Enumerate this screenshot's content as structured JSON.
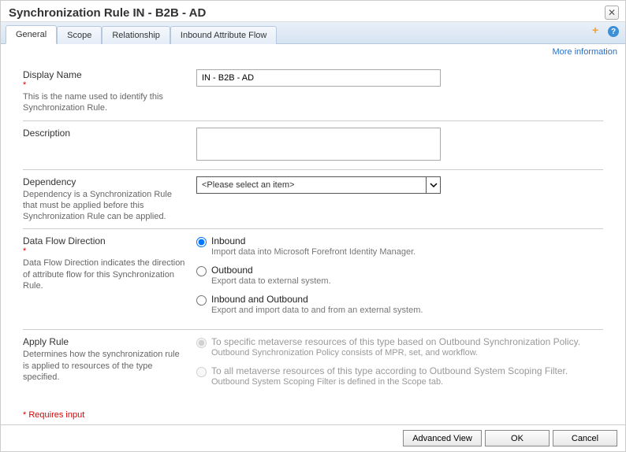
{
  "title": "Synchronization Rule IN - B2B - AD",
  "tabs": [
    "General",
    "Scope",
    "Relationship",
    "Inbound Attribute Flow"
  ],
  "activeTab": 0,
  "moreInfoLabel": "More information",
  "fields": {
    "displayName": {
      "label": "Display Name",
      "help": "This is the name used to identify this Synchronization Rule.",
      "value": "IN - B2B - AD",
      "required": true
    },
    "description": {
      "label": "Description",
      "value": ""
    },
    "dependency": {
      "label": "Dependency",
      "help": "Dependency is a Synchronization Rule that must be applied before this Synchronization Rule can be applied.",
      "placeholder": "<Please select an item>"
    },
    "dataFlow": {
      "label": "Data Flow Direction",
      "help": "Data Flow Direction indicates the direction of attribute flow for this Synchronization Rule.",
      "required": true,
      "options": [
        {
          "label": "Inbound",
          "desc": "Import data into Microsoft Forefront Identity Manager.",
          "selected": true
        },
        {
          "label": "Outbound",
          "desc": "Export data to external system.",
          "selected": false
        },
        {
          "label": "Inbound and Outbound",
          "desc": "Export and import data to and from an external system.",
          "selected": false
        }
      ]
    },
    "applyRule": {
      "label": "Apply Rule",
      "help": "Determines how the synchronization rule is applied to resources of the type specified.",
      "options": [
        {
          "label": "To specific metaverse resources of this type based on Outbound Synchronization Policy.",
          "desc": "Outbound Synchronization Policy consists of MPR, set, and workflow.",
          "selected": true
        },
        {
          "label": "To all metaverse resources of this type according to Outbound System Scoping Filter.",
          "desc": "Outbound System Scoping Filter is defined in the Scope tab.",
          "selected": false
        }
      ]
    }
  },
  "requiredNote": "* Requires input",
  "buttons": {
    "advanced": "Advanced View",
    "ok": "OK",
    "cancel": "Cancel"
  }
}
